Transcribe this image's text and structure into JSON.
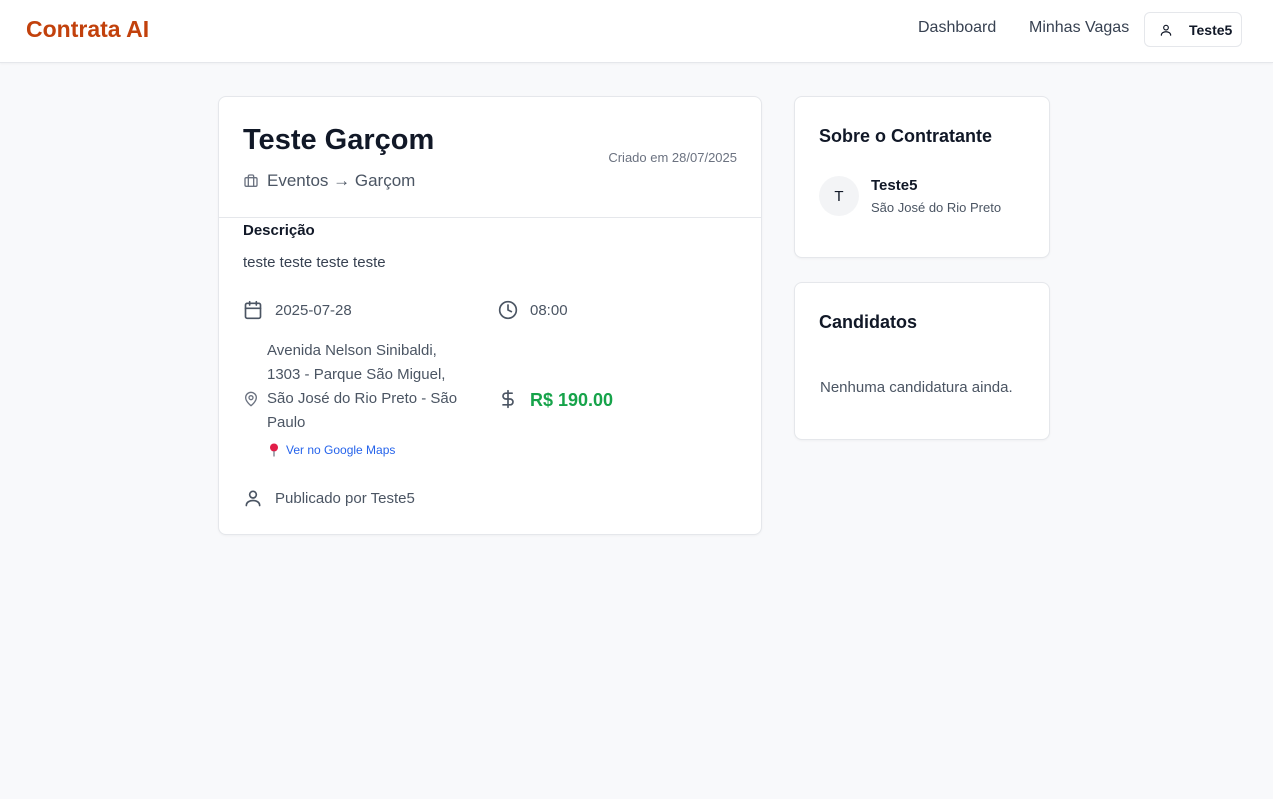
{
  "header": {
    "brand": "Contrata AI",
    "nav": {
      "dashboard": "Dashboard",
      "my_jobs": "Minhas Vagas"
    },
    "user": {
      "name": "Teste5",
      "icon": "user-icon"
    }
  },
  "job": {
    "title": "Teste Garçom",
    "created": "Criado em 28/07/2025",
    "category": "Eventos → Garçom",
    "category_icon": "briefcase-icon",
    "description_label": "Descrição",
    "description": "teste teste teste teste",
    "date": "2025-07-28",
    "time": "08:00",
    "address": "Avenida Nelson Sinibaldi, 1303 - Parque São Miguel, São José do Rio Preto - São Paulo",
    "maps_link": "Ver no Google Maps",
    "price": "R$ 190.00",
    "published_by": "Publicado por Teste5"
  },
  "contractor": {
    "title": "Sobre o Contratante",
    "initial": "T",
    "name": "Teste5",
    "city": "São José do Rio Preto"
  },
  "candidates": {
    "title": "Candidatos",
    "empty": "Nenhuma candidatura ainda."
  },
  "colors": {
    "brand": "#c2410c",
    "price": "#16a34a",
    "link": "#2563eb"
  }
}
